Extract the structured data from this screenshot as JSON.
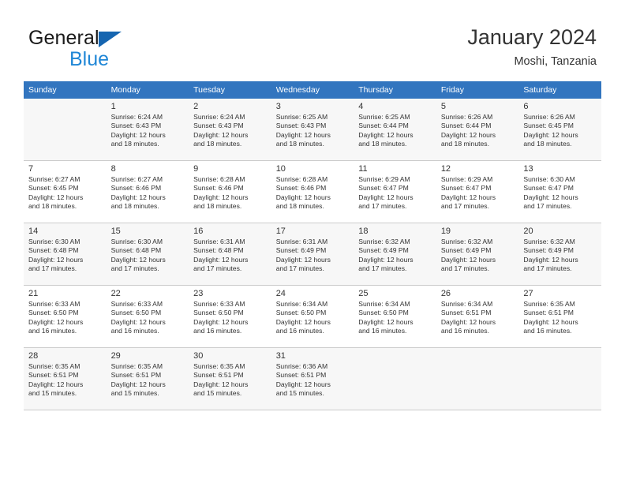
{
  "brand": {
    "name_part1": "General",
    "name_part2": "Blue",
    "logo_icon": "triangle-flag-icon"
  },
  "header": {
    "title": "January 2024",
    "subtitle": "Moshi, Tanzania"
  },
  "calendar": {
    "weekday_headers": [
      "Sunday",
      "Monday",
      "Tuesday",
      "Wednesday",
      "Thursday",
      "Friday",
      "Saturday"
    ],
    "header_bg": "#3275bf",
    "alt_row_bg": "#f7f7f7",
    "weeks": [
      [
        {
          "day": "",
          "sunrise": "",
          "sunset": "",
          "daylight1": "",
          "daylight2": ""
        },
        {
          "day": "1",
          "sunrise": "Sunrise: 6:24 AM",
          "sunset": "Sunset: 6:43 PM",
          "daylight1": "Daylight: 12 hours",
          "daylight2": "and 18 minutes."
        },
        {
          "day": "2",
          "sunrise": "Sunrise: 6:24 AM",
          "sunset": "Sunset: 6:43 PM",
          "daylight1": "Daylight: 12 hours",
          "daylight2": "and 18 minutes."
        },
        {
          "day": "3",
          "sunrise": "Sunrise: 6:25 AM",
          "sunset": "Sunset: 6:43 PM",
          "daylight1": "Daylight: 12 hours",
          "daylight2": "and 18 minutes."
        },
        {
          "day": "4",
          "sunrise": "Sunrise: 6:25 AM",
          "sunset": "Sunset: 6:44 PM",
          "daylight1": "Daylight: 12 hours",
          "daylight2": "and 18 minutes."
        },
        {
          "day": "5",
          "sunrise": "Sunrise: 6:26 AM",
          "sunset": "Sunset: 6:44 PM",
          "daylight1": "Daylight: 12 hours",
          "daylight2": "and 18 minutes."
        },
        {
          "day": "6",
          "sunrise": "Sunrise: 6:26 AM",
          "sunset": "Sunset: 6:45 PM",
          "daylight1": "Daylight: 12 hours",
          "daylight2": "and 18 minutes."
        }
      ],
      [
        {
          "day": "7",
          "sunrise": "Sunrise: 6:27 AM",
          "sunset": "Sunset: 6:45 PM",
          "daylight1": "Daylight: 12 hours",
          "daylight2": "and 18 minutes."
        },
        {
          "day": "8",
          "sunrise": "Sunrise: 6:27 AM",
          "sunset": "Sunset: 6:46 PM",
          "daylight1": "Daylight: 12 hours",
          "daylight2": "and 18 minutes."
        },
        {
          "day": "9",
          "sunrise": "Sunrise: 6:28 AM",
          "sunset": "Sunset: 6:46 PM",
          "daylight1": "Daylight: 12 hours",
          "daylight2": "and 18 minutes."
        },
        {
          "day": "10",
          "sunrise": "Sunrise: 6:28 AM",
          "sunset": "Sunset: 6:46 PM",
          "daylight1": "Daylight: 12 hours",
          "daylight2": "and 18 minutes."
        },
        {
          "day": "11",
          "sunrise": "Sunrise: 6:29 AM",
          "sunset": "Sunset: 6:47 PM",
          "daylight1": "Daylight: 12 hours",
          "daylight2": "and 17 minutes."
        },
        {
          "day": "12",
          "sunrise": "Sunrise: 6:29 AM",
          "sunset": "Sunset: 6:47 PM",
          "daylight1": "Daylight: 12 hours",
          "daylight2": "and 17 minutes."
        },
        {
          "day": "13",
          "sunrise": "Sunrise: 6:30 AM",
          "sunset": "Sunset: 6:47 PM",
          "daylight1": "Daylight: 12 hours",
          "daylight2": "and 17 minutes."
        }
      ],
      [
        {
          "day": "14",
          "sunrise": "Sunrise: 6:30 AM",
          "sunset": "Sunset: 6:48 PM",
          "daylight1": "Daylight: 12 hours",
          "daylight2": "and 17 minutes."
        },
        {
          "day": "15",
          "sunrise": "Sunrise: 6:30 AM",
          "sunset": "Sunset: 6:48 PM",
          "daylight1": "Daylight: 12 hours",
          "daylight2": "and 17 minutes."
        },
        {
          "day": "16",
          "sunrise": "Sunrise: 6:31 AM",
          "sunset": "Sunset: 6:48 PM",
          "daylight1": "Daylight: 12 hours",
          "daylight2": "and 17 minutes."
        },
        {
          "day": "17",
          "sunrise": "Sunrise: 6:31 AM",
          "sunset": "Sunset: 6:49 PM",
          "daylight1": "Daylight: 12 hours",
          "daylight2": "and 17 minutes."
        },
        {
          "day": "18",
          "sunrise": "Sunrise: 6:32 AM",
          "sunset": "Sunset: 6:49 PM",
          "daylight1": "Daylight: 12 hours",
          "daylight2": "and 17 minutes."
        },
        {
          "day": "19",
          "sunrise": "Sunrise: 6:32 AM",
          "sunset": "Sunset: 6:49 PM",
          "daylight1": "Daylight: 12 hours",
          "daylight2": "and 17 minutes."
        },
        {
          "day": "20",
          "sunrise": "Sunrise: 6:32 AM",
          "sunset": "Sunset: 6:49 PM",
          "daylight1": "Daylight: 12 hours",
          "daylight2": "and 17 minutes."
        }
      ],
      [
        {
          "day": "21",
          "sunrise": "Sunrise: 6:33 AM",
          "sunset": "Sunset: 6:50 PM",
          "daylight1": "Daylight: 12 hours",
          "daylight2": "and 16 minutes."
        },
        {
          "day": "22",
          "sunrise": "Sunrise: 6:33 AM",
          "sunset": "Sunset: 6:50 PM",
          "daylight1": "Daylight: 12 hours",
          "daylight2": "and 16 minutes."
        },
        {
          "day": "23",
          "sunrise": "Sunrise: 6:33 AM",
          "sunset": "Sunset: 6:50 PM",
          "daylight1": "Daylight: 12 hours",
          "daylight2": "and 16 minutes."
        },
        {
          "day": "24",
          "sunrise": "Sunrise: 6:34 AM",
          "sunset": "Sunset: 6:50 PM",
          "daylight1": "Daylight: 12 hours",
          "daylight2": "and 16 minutes."
        },
        {
          "day": "25",
          "sunrise": "Sunrise: 6:34 AM",
          "sunset": "Sunset: 6:50 PM",
          "daylight1": "Daylight: 12 hours",
          "daylight2": "and 16 minutes."
        },
        {
          "day": "26",
          "sunrise": "Sunrise: 6:34 AM",
          "sunset": "Sunset: 6:51 PM",
          "daylight1": "Daylight: 12 hours",
          "daylight2": "and 16 minutes."
        },
        {
          "day": "27",
          "sunrise": "Sunrise: 6:35 AM",
          "sunset": "Sunset: 6:51 PM",
          "daylight1": "Daylight: 12 hours",
          "daylight2": "and 16 minutes."
        }
      ],
      [
        {
          "day": "28",
          "sunrise": "Sunrise: 6:35 AM",
          "sunset": "Sunset: 6:51 PM",
          "daylight1": "Daylight: 12 hours",
          "daylight2": "and 15 minutes."
        },
        {
          "day": "29",
          "sunrise": "Sunrise: 6:35 AM",
          "sunset": "Sunset: 6:51 PM",
          "daylight1": "Daylight: 12 hours",
          "daylight2": "and 15 minutes."
        },
        {
          "day": "30",
          "sunrise": "Sunrise: 6:35 AM",
          "sunset": "Sunset: 6:51 PM",
          "daylight1": "Daylight: 12 hours",
          "daylight2": "and 15 minutes."
        },
        {
          "day": "31",
          "sunrise": "Sunrise: 6:36 AM",
          "sunset": "Sunset: 6:51 PM",
          "daylight1": "Daylight: 12 hours",
          "daylight2": "and 15 minutes."
        },
        {
          "day": "",
          "sunrise": "",
          "sunset": "",
          "daylight1": "",
          "daylight2": ""
        },
        {
          "day": "",
          "sunrise": "",
          "sunset": "",
          "daylight1": "",
          "daylight2": ""
        },
        {
          "day": "",
          "sunrise": "",
          "sunset": "",
          "daylight1": "",
          "daylight2": ""
        }
      ]
    ]
  }
}
